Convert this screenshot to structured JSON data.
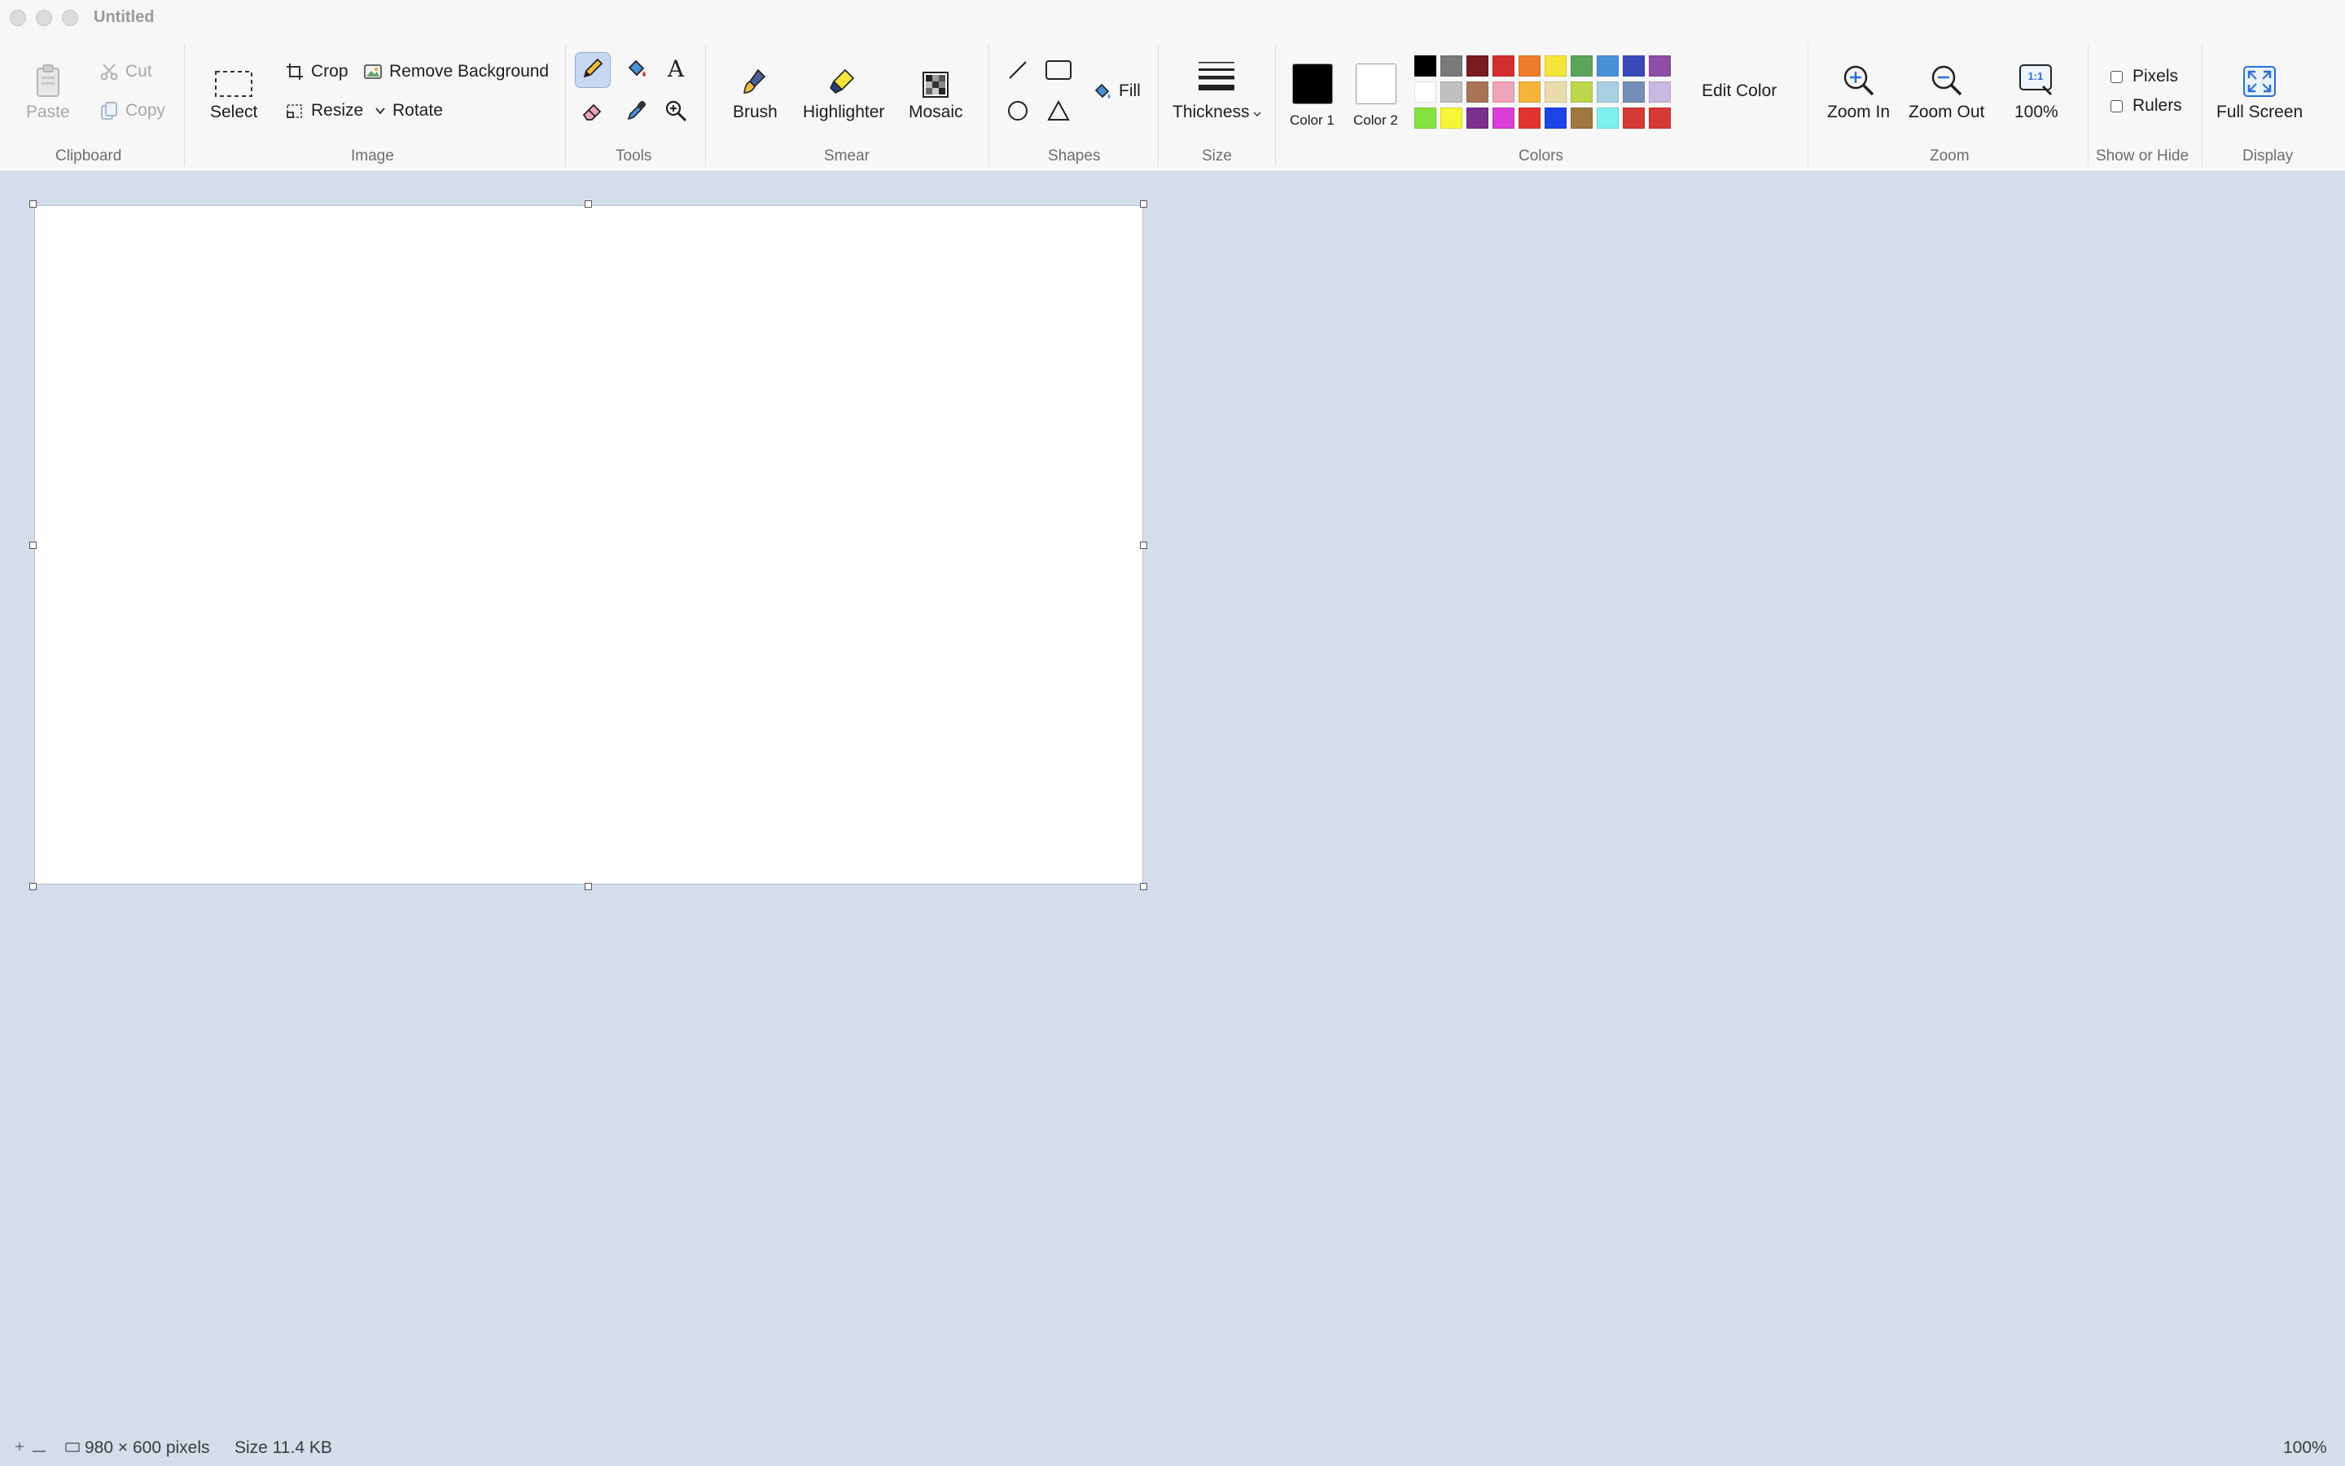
{
  "window": {
    "title": "Untitled"
  },
  "clipboard": {
    "paste": "Paste",
    "cut": "Cut",
    "copy": "Copy",
    "label": "Clipboard"
  },
  "image": {
    "select": "Select",
    "crop": "Crop",
    "remove_background": "Remove Background",
    "resize": "Resize",
    "rotate": "Rotate",
    "label": "Image"
  },
  "tools": {
    "label": "Tools",
    "active": "pencil"
  },
  "smear": {
    "brush": "Brush",
    "highlighter": "Highlighter",
    "mosaic": "Mosaic",
    "label": "Smear"
  },
  "shapes": {
    "fill": "Fill",
    "label": "Shapes"
  },
  "size": {
    "thickness": "Thickness",
    "label": "Size"
  },
  "colors": {
    "color1": "Color 1",
    "color2": "Color 2",
    "color1_value": "#000000",
    "color2_value": "#ffffff",
    "edit_color": "Edit Color",
    "label": "Colors",
    "palette": [
      [
        "#000000",
        "#7a7a7a",
        "#7b1a1f",
        "#d32f2f",
        "#ef7d2a",
        "#f7e43a",
        "#5aa55a",
        "#4a90d9",
        "#3a49b8",
        "#8d4ea5"
      ],
      [
        "#ffffff",
        "#c0c0c0",
        "#a97456",
        "#f0a4b8",
        "#f5b43c",
        "#eddcab",
        "#bcd84a",
        "#a8cfe4",
        "#7390b8",
        "#c8b9e3"
      ],
      [
        "#86e33f",
        "#f8f43a",
        "#7b2f8f",
        "#d83fd6",
        "#e0352e",
        "#1c44e6",
        "#a0773e",
        "#7ef0f0",
        "#d63a36",
        "#d63a36"
      ]
    ]
  },
  "zoom": {
    "zoom_in": "Zoom In",
    "zoom_out": "Zoom Out",
    "actual": "100%",
    "actual_icon_text": "1:1",
    "label": "Zoom"
  },
  "show_hide": {
    "pixels": "Pixels",
    "rulers": "Rulers",
    "label": "Show or Hide"
  },
  "display": {
    "full_screen": "Full Screen",
    "label": "Display"
  },
  "status": {
    "dimensions": "980 × 600 pixels",
    "file_size": "Size 11.4 KB",
    "zoom": "100%"
  }
}
